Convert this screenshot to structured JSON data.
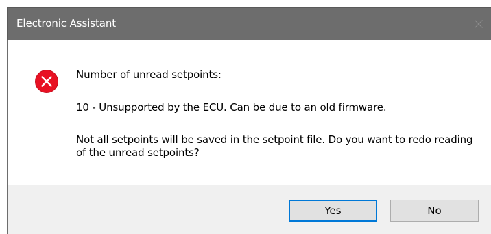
{
  "window": {
    "title": "Electronic Assistant",
    "close_icon": "close-icon"
  },
  "message": {
    "icon": "error-icon",
    "line1": "Number of unread setpoints:",
    "line2": "10 - Unsupported by the ECU. Can be due to an old firmware.",
    "line3": "Not all setpoints will be saved in the setpoint file. Do you want to redo reading of the unread setpoints?"
  },
  "buttons": {
    "yes_label": "Yes",
    "no_label": "No"
  },
  "colors": {
    "titlebar": "#6d6d6d",
    "error_red": "#e81123",
    "footer_bg": "#f0f0f0",
    "focus_border": "#0078d7"
  }
}
